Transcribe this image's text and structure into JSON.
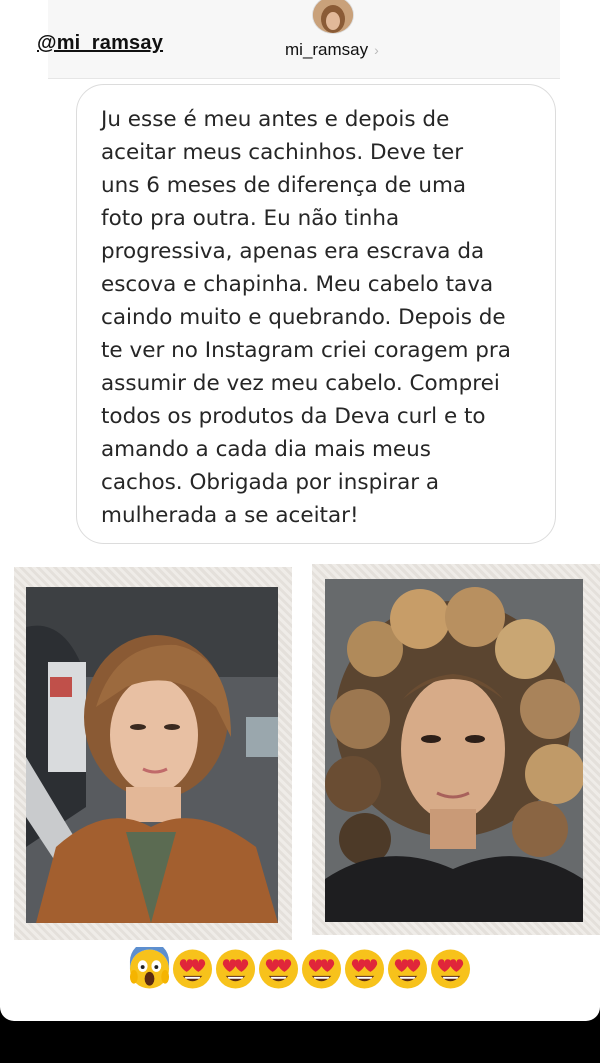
{
  "mention": "@mi_ramsay",
  "header": {
    "username": "mi_ramsay",
    "chevron": "›"
  },
  "message": {
    "lines": [
      "Ju esse é meu antes e depois de",
      "aceitar meus cachinhos. Deve ter",
      "uns 6 meses de diferença de uma",
      "foto pra outra. Eu não tinha",
      "progressiva, apenas era escrava da",
      "escova e chapinha. Meu cabelo tava",
      "caindo muito e quebrando. Depois de",
      "te ver no Instagram criei coragem pra",
      "assumir de vez meu cabelo. Comprei",
      "todos os produtos da Deva curl e to",
      "amando a cada dia mais meus",
      "cachos. Obrigada por inspirar a",
      "mulherada a se aceitar!"
    ]
  },
  "photos": [
    {
      "name": "before-photo",
      "description_icon": "photo-icon"
    },
    {
      "name": "after-photo",
      "description_icon": "photo-icon"
    }
  ],
  "reactions": [
    "screaming-face-emoji",
    "heart-eyes-emoji",
    "heart-eyes-emoji",
    "heart-eyes-emoji",
    "heart-eyes-emoji",
    "heart-eyes-emoji",
    "heart-eyes-emoji",
    "heart-eyes-emoji"
  ],
  "colors": {
    "emoji_yellow": "#f7c21b",
    "heart_red": "#e0263a",
    "scream_blue": "#5d8fcf"
  }
}
